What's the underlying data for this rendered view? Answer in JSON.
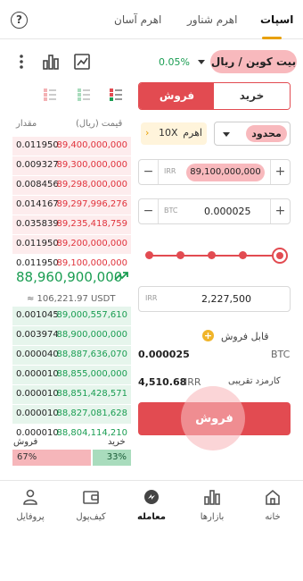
{
  "tabs": [
    {
      "label": "اسپات",
      "active": true
    },
    {
      "label": "اهرم شناور",
      "active": false
    },
    {
      "label": "اهرم آسان",
      "active": false
    }
  ],
  "header": {
    "market": "بیت کوین / ریال",
    "change": "0.05%"
  },
  "orderbook": {
    "price_header": "قیمت (ریال)",
    "amount_header": "مقدار",
    "asks": [
      {
        "price": "89,400,000,000",
        "amount": "0.011950"
      },
      {
        "price": "89,300,000,000",
        "amount": "0.009327"
      },
      {
        "price": "89,298,000,000",
        "amount": "0.008456"
      },
      {
        "price": "89,297,996,276",
        "amount": "0.014167"
      },
      {
        "price": "89,235,418,759",
        "amount": "0.035839"
      },
      {
        "price": "89,200,000,000",
        "amount": "0.011950"
      },
      {
        "price": "89,100,000,000",
        "amount": "0.011950"
      }
    ],
    "last_price": "88,960,900,000",
    "usdt_price": "≈ 106,221.97 USDT",
    "bids": [
      {
        "price": "89,000,557,610",
        "amount": "0.001045"
      },
      {
        "price": "88,900,000,000",
        "amount": "0.003974"
      },
      {
        "price": "88,887,636,070",
        "amount": "0.000040"
      },
      {
        "price": "88,855,000,000",
        "amount": "0.000010"
      },
      {
        "price": "88,851,428,571",
        "amount": "0.000010"
      },
      {
        "price": "88,827,081,628",
        "amount": "0.000010"
      },
      {
        "price": "88,804,114,210",
        "amount": "0.000010"
      }
    ],
    "buy_label": "خرید",
    "sell_label": "فروش",
    "buy_ratio": "33%",
    "sell_ratio": "67%",
    "buy_fraction": 0.33,
    "sell_fraction": 0.67
  },
  "form": {
    "buy_tab": "خرید",
    "sell_tab": "فروش",
    "order_type": "محدود",
    "leverage_label": "اهرم",
    "leverage_value": "10X",
    "price_unit": "IRR",
    "price_value": "89,100,000,000",
    "amount_unit": "BTC",
    "amount_value": "0.000025",
    "slider_fraction": 1.0,
    "total_unit": "IRR",
    "total_value": "2,227,500",
    "available_label": "قابل فروش",
    "available_value": "0.000025",
    "available_unit": "BTC",
    "fee_label": "کارمزد تقریبی",
    "fee_value": "4,510.68",
    "fee_unit": "IRR",
    "submit_label": "فروش"
  },
  "nav": [
    {
      "label": "خانه",
      "icon": "home-icon"
    },
    {
      "label": "بازارها",
      "icon": "markets-icon"
    },
    {
      "label": "معامله",
      "icon": "trade-icon",
      "active": true
    },
    {
      "label": "کیف‌پول",
      "icon": "wallet-icon"
    },
    {
      "label": "پروفایل",
      "icon": "profile-icon"
    }
  ],
  "colors": {
    "buy": "#1a9d52",
    "sell": "#e24b51",
    "accent": "#e8a000"
  }
}
